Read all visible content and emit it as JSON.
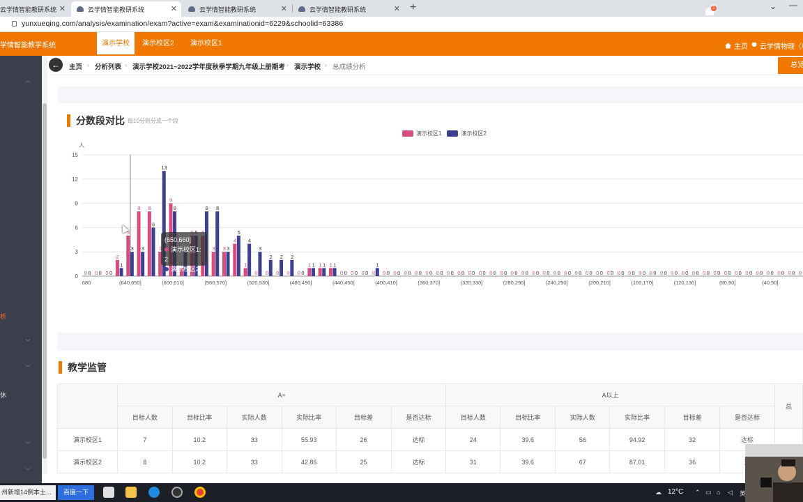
{
  "browser": {
    "tabs": [
      {
        "title": "云学情智能教研系统",
        "active": false
      },
      {
        "title": "云学情智能教研系统",
        "active": true
      },
      {
        "title": "云学情智能教研系统",
        "active": false
      },
      {
        "title": "云学情智能教研系统",
        "active": false
      }
    ],
    "new_tab": "+",
    "url": "yunxueqing.com/analysis/examination/exam?active=exam&examinationid=6229&schoolid=63386"
  },
  "header": {
    "brand": "学情智能教学系统",
    "tabs": [
      "演示学校",
      "演示校区2",
      "演示校区1"
    ],
    "notification_count": "1",
    "home_label": "主页",
    "user_label": "云学情物理（校"
  },
  "sidebar": {
    "partial_labels": [
      "析",
      "",
      "休"
    ]
  },
  "breadcrumb": {
    "items": [
      "主页",
      "分析列表",
      "演示学校2021~2022学年度秋季学期九年级上册期考",
      "演示学校",
      "总成绩分析"
    ],
    "summary_button": "总览"
  },
  "score_section": {
    "title": "分数段对比",
    "note": "每10分则分成一个段",
    "y_unit": "人",
    "tooltip": {
      "header": "(650,660]",
      "lines": [
        "演示校区1: 2",
        "演示校区2: 1"
      ]
    }
  },
  "chart_data": {
    "type": "bar",
    "title": "分数段对比",
    "ylabel": "人",
    "ylim": [
      0,
      15
    ],
    "yticks": [
      0,
      3,
      6,
      9,
      12,
      15
    ],
    "legend_position": "top-center",
    "series": [
      {
        "name": "演示校区1",
        "color": "#d64d7f",
        "values": [
          0,
          0,
          0,
          2,
          5,
          8,
          8,
          3,
          9,
          1,
          5,
          5,
          3,
          3,
          4,
          1,
          0,
          0,
          0,
          0,
          0,
          1,
          1,
          1,
          0,
          0,
          0,
          0,
          0,
          0,
          0,
          0,
          0,
          0,
          0,
          0,
          0,
          0,
          0,
          0,
          0,
          0,
          0,
          0,
          0,
          0,
          0,
          0,
          0,
          0,
          0,
          0,
          0,
          0,
          0,
          0,
          0,
          0,
          0,
          0,
          0,
          0,
          0,
          0,
          0,
          0,
          0,
          0
        ]
      },
      {
        "name": "演示校区2",
        "color": "#3d3f91",
        "values": [
          0,
          0,
          0,
          1,
          3,
          3,
          6,
          13,
          8,
          3,
          5,
          8,
          8,
          3,
          5,
          4,
          3,
          2,
          2,
          2,
          0,
          1,
          1,
          1,
          0,
          0,
          0,
          1,
          0,
          0,
          0,
          0,
          0,
          0,
          0,
          0,
          0,
          0,
          0,
          0,
          0,
          0,
          0,
          0,
          0,
          0,
          0,
          0,
          0,
          0,
          0,
          0,
          0,
          0,
          0,
          0,
          0,
          0,
          0,
          0,
          0,
          0,
          0,
          0,
          0,
          0,
          0,
          0
        ]
      }
    ],
    "x_tick_labels": [
      "680",
      "(640,650]",
      "(600,610]",
      "(560,570]",
      "(520,530]",
      "(480,490]",
      "(440,450]",
      "(400,410]",
      "(360,370]",
      "(320,330]",
      "(280,290]",
      "(240,250]",
      "(200,210]",
      "(160,170]",
      "(120,130]",
      "(80,90]",
      "(40,50]"
    ]
  },
  "supervision": {
    "title": "教学监管",
    "groups": [
      "A+",
      "A以上",
      "总"
    ],
    "sub_headers": [
      "目标人数",
      "目标比率",
      "实际人数",
      "实际比率",
      "目标差",
      "是否达标"
    ],
    "rows": [
      {
        "name": "演示校区1",
        "a_plus": [
          "7",
          "10.2",
          "33",
          "55.93",
          "26",
          "达标"
        ],
        "a_above": [
          "24",
          "39.6",
          "56",
          "94.92",
          "32",
          "达标"
        ]
      },
      {
        "name": "演示校区2",
        "a_plus": [
          "8",
          "10.2",
          "33",
          "42.86",
          "25",
          "达标"
        ],
        "a_above": [
          "31",
          "39.6",
          "67",
          "87.01",
          "36",
          "达"
        ]
      }
    ]
  },
  "taskbar": {
    "search_text": "州新增14例本土...",
    "search_button": "百度一下",
    "temperature": "12°C",
    "ime": "英"
  }
}
